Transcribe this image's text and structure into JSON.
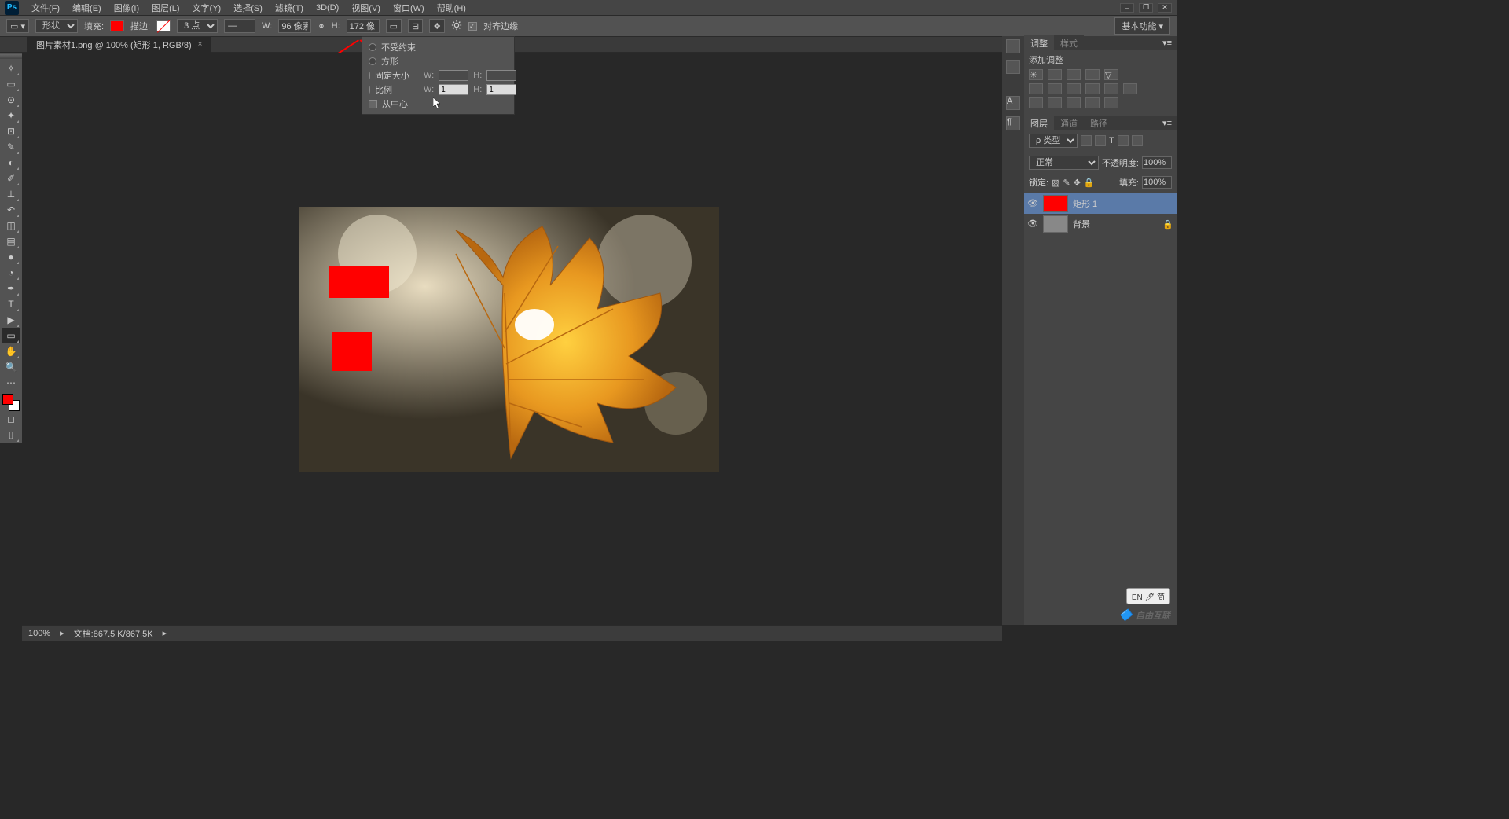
{
  "app": {
    "logo": "Ps"
  },
  "menu": [
    "文件(F)",
    "编辑(E)",
    "图像(I)",
    "图层(L)",
    "文字(Y)",
    "选择(S)",
    "滤镜(T)",
    "3D(D)",
    "视图(V)",
    "窗口(W)",
    "帮助(H)"
  ],
  "options": {
    "shape_mode": "形状",
    "fill_label": "填充:",
    "stroke_label": "描边:",
    "stroke_width": "3 点",
    "w_label": "W:",
    "w_value": "96 像素",
    "h_label": "H:",
    "h_value": "172 像",
    "align_edges": "对齐边缘",
    "workspace": "基本功能"
  },
  "popup": {
    "r1": "不受约束",
    "r2": "方形",
    "r3": "固定大小",
    "r4": "比例",
    "c1": "从中心",
    "w_label": "W:",
    "h_label": "H:",
    "w_val": "1",
    "h_val": "1"
  },
  "doc_tab": "图片素材1.png @ 100% (矩形 1, RGB/8)",
  "adjustments": {
    "tab1": "调整",
    "tab2": "样式",
    "title": "添加调整"
  },
  "layers_panel": {
    "tab1": "图层",
    "tab2": "通道",
    "tab3": "路径",
    "kind": "ρ 类型",
    "blend": "正常",
    "opacity_label": "不透明度:",
    "opacity": "100%",
    "lock_label": "锁定:",
    "fill_label": "填充:",
    "fill": "100%",
    "layers": [
      {
        "name": "矩形 1"
      },
      {
        "name": "背景"
      }
    ]
  },
  "status": {
    "zoom": "100%",
    "doc_info": "文档:867.5 K/867.5K"
  },
  "watermark": "自由互联",
  "ime": "EN 🖊 简"
}
